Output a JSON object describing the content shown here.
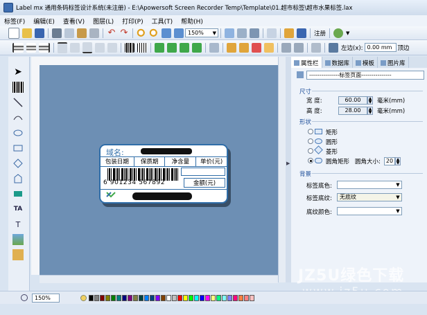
{
  "title": "Label mx 通用条码标签设计系统(未注册) - E:\\Apowersoft Screen Recorder Temp\\Template\\01.超市标签\\超市水果标签.lax",
  "menu": [
    "标签(F)",
    "编辑(E)",
    "查看(V)",
    "图层(L)",
    "打印(P)",
    "工具(T)",
    "帮助(H)"
  ],
  "toolbar": {
    "zoom_value": "150%",
    "register_label": "注册",
    "left_margin_label": "左边(x):",
    "left_margin_value": "0.00 mm",
    "top_margin_label": "顶边"
  },
  "label": {
    "domain_text": "域名:",
    "columns": [
      "包装日期",
      "保质期",
      "净含量",
      "单价(元)"
    ],
    "barcode_text": "6 901234 567892",
    "amount_label": "金额(元)"
  },
  "panel": {
    "tabs": [
      "属性栏",
      "数据库",
      "模板",
      "图片库"
    ],
    "page_select": "---------------标签页面---------------",
    "size_section": "尺寸",
    "width_label": "宽    度:",
    "width_value": "60.00",
    "height_label": "高    度:",
    "height_value": "28.00",
    "unit": "毫米(mm)",
    "shape_section": "形状",
    "shapes": [
      "矩形",
      "圆形",
      "菱形",
      "圆角矩形"
    ],
    "corner_label": "圆角大小:",
    "corner_value": "20",
    "bg_section": "背景",
    "bg_color_label": "标签底色:",
    "bg_texture_label": "标签底纹:",
    "bg_texture_value": "无底纹",
    "texture_color_label": "底纹颜色:"
  },
  "status": {
    "zoom": "150%"
  },
  "watermark": {
    "brand": "JZ5U绿色下载",
    "url": "www.jz5u.com"
  },
  "palette": [
    "#000000",
    "#808080",
    "#800000",
    "#808000",
    "#008000",
    "#008080",
    "#000080",
    "#800080",
    "#808040",
    "#004040",
    "#0080ff",
    "#004080",
    "#8000ff",
    "#804000",
    "#ffffff",
    "#c0c0c0",
    "#ff0000",
    "#ffff00",
    "#00ff00",
    "#00ffff",
    "#0000ff",
    "#ff00ff",
    "#ffff80",
    "#00ff80",
    "#80ffff",
    "#8080ff",
    "#ff0080",
    "#ff8040",
    "#ff8080",
    "#ffc0c0"
  ]
}
